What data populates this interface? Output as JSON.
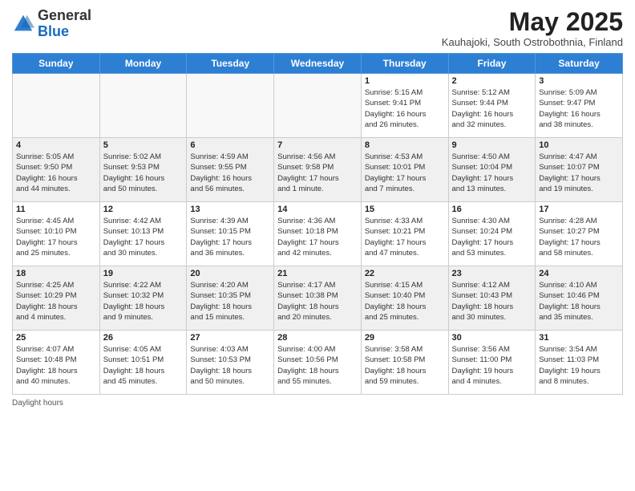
{
  "logo": {
    "general": "General",
    "blue": "Blue"
  },
  "title": "May 2025",
  "subtitle": "Kauhajoki, South Ostrobothnia, Finland",
  "headers": [
    "Sunday",
    "Monday",
    "Tuesday",
    "Wednesday",
    "Thursday",
    "Friday",
    "Saturday"
  ],
  "footer_text": "Daylight hours",
  "weeks": [
    [
      {
        "day": "",
        "info": "",
        "empty": true
      },
      {
        "day": "",
        "info": "",
        "empty": true
      },
      {
        "day": "",
        "info": "",
        "empty": true
      },
      {
        "day": "",
        "info": "",
        "empty": true
      },
      {
        "day": "1",
        "info": "Sunrise: 5:15 AM\nSunset: 9:41 PM\nDaylight: 16 hours\nand 26 minutes."
      },
      {
        "day": "2",
        "info": "Sunrise: 5:12 AM\nSunset: 9:44 PM\nDaylight: 16 hours\nand 32 minutes."
      },
      {
        "day": "3",
        "info": "Sunrise: 5:09 AM\nSunset: 9:47 PM\nDaylight: 16 hours\nand 38 minutes."
      }
    ],
    [
      {
        "day": "4",
        "info": "Sunrise: 5:05 AM\nSunset: 9:50 PM\nDaylight: 16 hours\nand 44 minutes.",
        "shaded": true
      },
      {
        "day": "5",
        "info": "Sunrise: 5:02 AM\nSunset: 9:53 PM\nDaylight: 16 hours\nand 50 minutes.",
        "shaded": true
      },
      {
        "day": "6",
        "info": "Sunrise: 4:59 AM\nSunset: 9:55 PM\nDaylight: 16 hours\nand 56 minutes.",
        "shaded": true
      },
      {
        "day": "7",
        "info": "Sunrise: 4:56 AM\nSunset: 9:58 PM\nDaylight: 17 hours\nand 1 minute.",
        "shaded": true
      },
      {
        "day": "8",
        "info": "Sunrise: 4:53 AM\nSunset: 10:01 PM\nDaylight: 17 hours\nand 7 minutes.",
        "shaded": true
      },
      {
        "day": "9",
        "info": "Sunrise: 4:50 AM\nSunset: 10:04 PM\nDaylight: 17 hours\nand 13 minutes.",
        "shaded": true
      },
      {
        "day": "10",
        "info": "Sunrise: 4:47 AM\nSunset: 10:07 PM\nDaylight: 17 hours\nand 19 minutes.",
        "shaded": true
      }
    ],
    [
      {
        "day": "11",
        "info": "Sunrise: 4:45 AM\nSunset: 10:10 PM\nDaylight: 17 hours\nand 25 minutes."
      },
      {
        "day": "12",
        "info": "Sunrise: 4:42 AM\nSunset: 10:13 PM\nDaylight: 17 hours\nand 30 minutes."
      },
      {
        "day": "13",
        "info": "Sunrise: 4:39 AM\nSunset: 10:15 PM\nDaylight: 17 hours\nand 36 minutes."
      },
      {
        "day": "14",
        "info": "Sunrise: 4:36 AM\nSunset: 10:18 PM\nDaylight: 17 hours\nand 42 minutes."
      },
      {
        "day": "15",
        "info": "Sunrise: 4:33 AM\nSunset: 10:21 PM\nDaylight: 17 hours\nand 47 minutes."
      },
      {
        "day": "16",
        "info": "Sunrise: 4:30 AM\nSunset: 10:24 PM\nDaylight: 17 hours\nand 53 minutes."
      },
      {
        "day": "17",
        "info": "Sunrise: 4:28 AM\nSunset: 10:27 PM\nDaylight: 17 hours\nand 58 minutes."
      }
    ],
    [
      {
        "day": "18",
        "info": "Sunrise: 4:25 AM\nSunset: 10:29 PM\nDaylight: 18 hours\nand 4 minutes.",
        "shaded": true
      },
      {
        "day": "19",
        "info": "Sunrise: 4:22 AM\nSunset: 10:32 PM\nDaylight: 18 hours\nand 9 minutes.",
        "shaded": true
      },
      {
        "day": "20",
        "info": "Sunrise: 4:20 AM\nSunset: 10:35 PM\nDaylight: 18 hours\nand 15 minutes.",
        "shaded": true
      },
      {
        "day": "21",
        "info": "Sunrise: 4:17 AM\nSunset: 10:38 PM\nDaylight: 18 hours\nand 20 minutes.",
        "shaded": true
      },
      {
        "day": "22",
        "info": "Sunrise: 4:15 AM\nSunset: 10:40 PM\nDaylight: 18 hours\nand 25 minutes.",
        "shaded": true
      },
      {
        "day": "23",
        "info": "Sunrise: 4:12 AM\nSunset: 10:43 PM\nDaylight: 18 hours\nand 30 minutes.",
        "shaded": true
      },
      {
        "day": "24",
        "info": "Sunrise: 4:10 AM\nSunset: 10:46 PM\nDaylight: 18 hours\nand 35 minutes.",
        "shaded": true
      }
    ],
    [
      {
        "day": "25",
        "info": "Sunrise: 4:07 AM\nSunset: 10:48 PM\nDaylight: 18 hours\nand 40 minutes."
      },
      {
        "day": "26",
        "info": "Sunrise: 4:05 AM\nSunset: 10:51 PM\nDaylight: 18 hours\nand 45 minutes."
      },
      {
        "day": "27",
        "info": "Sunrise: 4:03 AM\nSunset: 10:53 PM\nDaylight: 18 hours\nand 50 minutes."
      },
      {
        "day": "28",
        "info": "Sunrise: 4:00 AM\nSunset: 10:56 PM\nDaylight: 18 hours\nand 55 minutes."
      },
      {
        "day": "29",
        "info": "Sunrise: 3:58 AM\nSunset: 10:58 PM\nDaylight: 18 hours\nand 59 minutes."
      },
      {
        "day": "30",
        "info": "Sunrise: 3:56 AM\nSunset: 11:00 PM\nDaylight: 19 hours\nand 4 minutes."
      },
      {
        "day": "31",
        "info": "Sunrise: 3:54 AM\nSunset: 11:03 PM\nDaylight: 19 hours\nand 8 minutes."
      }
    ]
  ]
}
